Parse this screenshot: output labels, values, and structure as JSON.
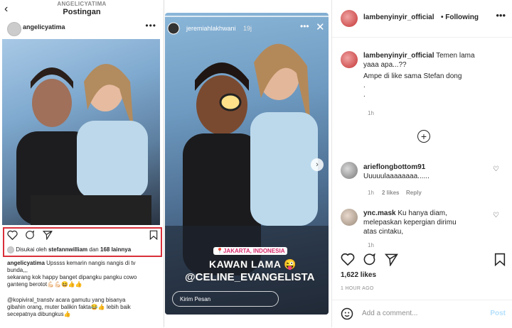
{
  "left_panel": {
    "profile_username": "ANGELICYATIMA",
    "screen_title": "Postingan",
    "back_icon": "chevron-left-icon",
    "post_author": "angelicyatima",
    "liked_by_prefix": "Disukai oleh",
    "liked_by_user": "stefannwilliam",
    "liked_by_mid": "dan",
    "liked_by_count": "168 lainnya",
    "caption_user": "angelicyatima",
    "caption_line1": "Upssss kemarin nangis nangis di tv",
    "caption_line2": "bunda,,,",
    "caption_line3": "sekarang kok happy banget dipangku pangku cowo",
    "caption_line4": "ganteng berotot💪🏻💪🏻😆👍👍",
    "comment_user": "@kopiviral_transtv",
    "comment_line1": "acara gamutu yang bisanya",
    "comment_line2": "gibahin orang, muter balikin fakta😂👍 lebih baik",
    "comment_line3": "secepatnya dibungkus👍"
  },
  "story": {
    "username": "jeremiahlakhwani",
    "time": "19j",
    "location": "📍JAKARTA, INDONESIA",
    "text_main": "KAWAN LAMA 😜",
    "mention": "@CELINE_EVANGELISTA",
    "reply_placeholder": "Kirim Pesan"
  },
  "right_panel": {
    "username": "lambenyinyir_official",
    "follow_status": "• Following",
    "caption_user": "lambenyinyir_official",
    "caption_line1": "Temen lama",
    "caption_line2": "yaaa apa...??",
    "caption_line3": "Ampe di like sama Stefan dong",
    "caption_line4": ".",
    "caption_line5": ".",
    "caption_time": "1h",
    "comments": [
      {
        "user": "arieflongbottom91",
        "text": "Uuuuulaaaaaaaa......",
        "time": "1h",
        "likes": "2 likes",
        "reply": "Reply"
      },
      {
        "user": "ync.mask",
        "line1": "Ku hanya diam,",
        "line2": "melepaskan kepergian dirimu",
        "line3": "atas cintaku,",
        "time": "1h"
      }
    ],
    "likes_count": "1,622 likes",
    "post_time": "1 HOUR AGO",
    "add_comment_placeholder": "Add a comment...",
    "post_label": "Post"
  },
  "colors": {
    "highlight_box": "#d9303a",
    "post_button": "#b2dffc",
    "story_location": "#d62a6b"
  }
}
